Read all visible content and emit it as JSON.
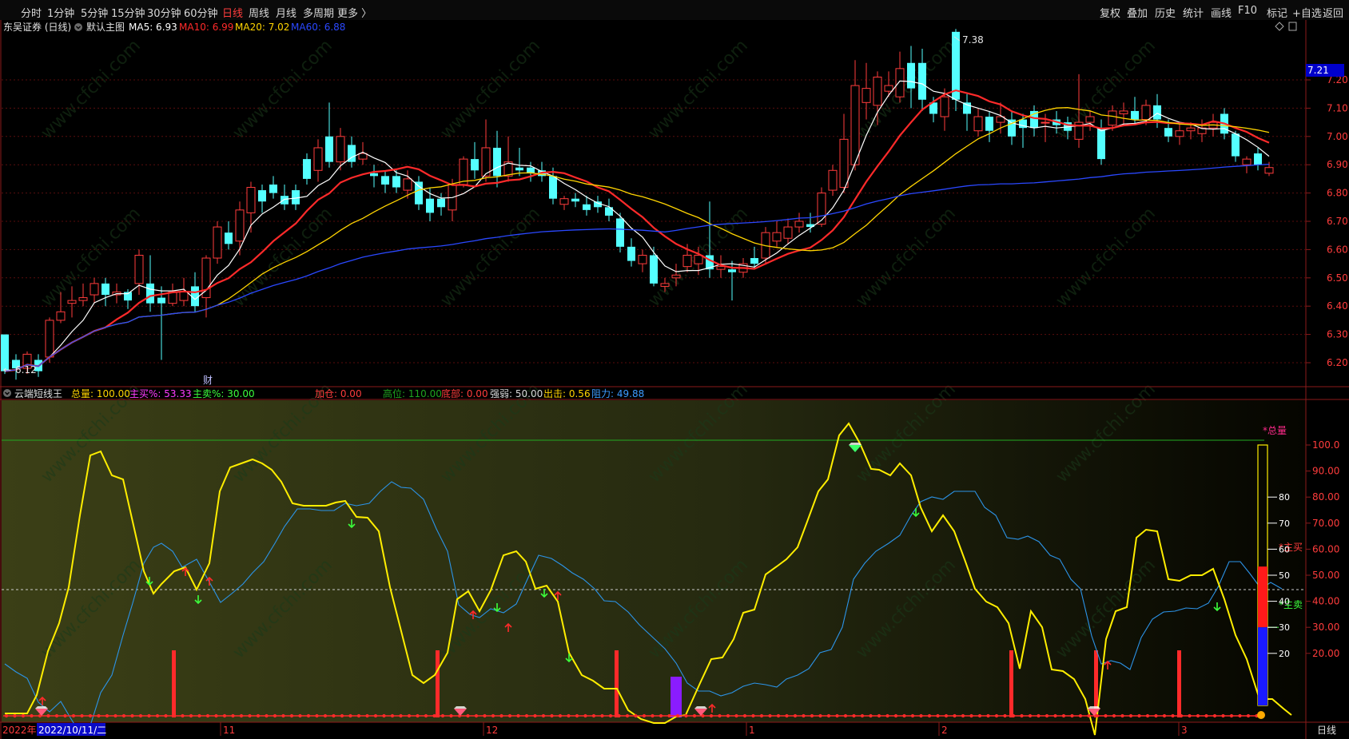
{
  "toolbar": {
    "periods": [
      "分时",
      "1分钟",
      "5分钟",
      "15分钟",
      "30分钟",
      "60分钟",
      "日线",
      "周线",
      "月线",
      "多周期",
      "更多 〉"
    ],
    "active_period": "日线",
    "right_buttons": [
      "复权",
      "叠加",
      "历史",
      "统计",
      "画线",
      "F10",
      "标记",
      "+自选",
      "返回"
    ]
  },
  "main_panel": {
    "stock_title": "东吴证券 (日线)",
    "indicator_name": "默认主图",
    "ma_labels": [
      {
        "text": "MA5: 6.93",
        "color": "#ffffff"
      },
      {
        "text": "MA10: 6.99",
        "color": "#ff2a2a"
      },
      {
        "text": "MA20: 7.02",
        "color": "#ffd400"
      },
      {
        "text": "MA60: 6.88",
        "color": "#2a48ff"
      }
    ],
    "high_label": "7.38",
    "low_label": "6.12",
    "current_price": "7.21",
    "price_ticks": [
      "7.20",
      "7.10",
      "7.00",
      "6.90",
      "6.80",
      "6.70",
      "6.60",
      "6.50",
      "6.40",
      "6.30",
      "6.20"
    ],
    "finance_marker": "财"
  },
  "sub_panel": {
    "indicator_name": "云端短线王",
    "values": [
      {
        "text": "总量: 100.00",
        "color": "#ffd400"
      },
      {
        "text": "主买%: 53.33",
        "color": "#ff3cff"
      },
      {
        "text": "主卖%: 30.00",
        "color": "#3cff3c"
      },
      {
        "text": "加仓: 0.00",
        "color": "#ff3c3c"
      },
      {
        "text": "高位: 110.00",
        "color": "#1fa31f"
      },
      {
        "text": "底部: 0.00",
        "color": "#ff3c3c"
      },
      {
        "text": "强弱: 50.00",
        "color": "#d8d8d8"
      },
      {
        "text": "出击: 0.56",
        "color": "#ffd400"
      },
      {
        "text": "阻力: 49.88",
        "color": "#3c9cff"
      }
    ],
    "axis_ticks": [
      "100.0",
      "90.00",
      "80.00",
      "70.00",
      "60.00",
      "50.00",
      "40.00",
      "30.00",
      "20.00"
    ],
    "bar_ticks": [
      "80",
      "70",
      "60",
      "50",
      "40",
      "30",
      "20"
    ],
    "legend_total": "*总量",
    "legend_buy": "*主买",
    "legend_sell": "*主卖"
  },
  "date_axis": {
    "year_label": "2022年",
    "cursor_date": "2022/10/11/二",
    "months": [
      "11",
      "12",
      "1",
      "2",
      "3"
    ]
  },
  "period_tag": "日线",
  "watermark_text": "www.cfchi.com",
  "colors": {
    "up": "#ff3c3c",
    "down": "#54ffff",
    "ma5": "#ffffff",
    "ma10": "#ff2a2a",
    "ma20": "#ffd400",
    "ma60": "#2a48ff"
  }
}
